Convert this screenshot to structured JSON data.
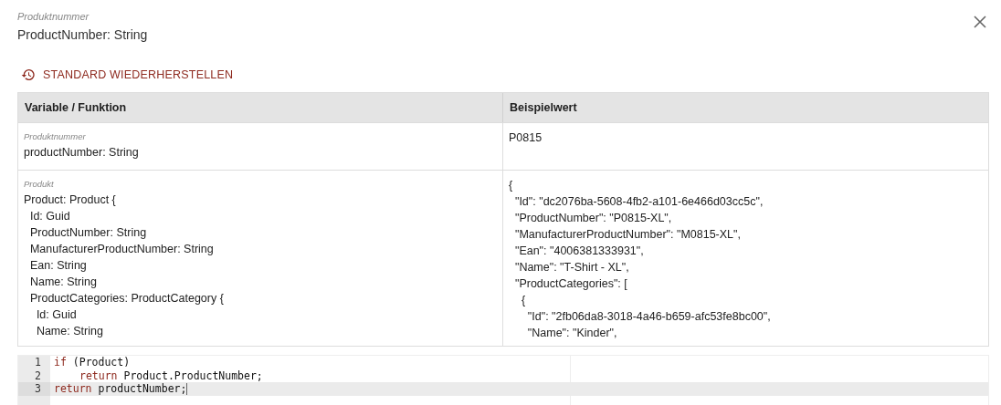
{
  "dialog": {
    "caption": "Produktnummer",
    "title": "ProductNumber: String"
  },
  "reset_button": {
    "label": "STANDARD WIEDERHERSTELLEN"
  },
  "table": {
    "columns": [
      "Variable / Funktion",
      "Beispielwert"
    ],
    "rows": [
      {
        "caption": "Produktnummer",
        "variable": [
          "productNumber: String"
        ],
        "example": [
          "P0815"
        ]
      },
      {
        "caption": "Produkt",
        "variable": [
          "Product: Product {",
          "  Id: Guid",
          "  ProductNumber: String",
          "  ManufacturerProductNumber: String",
          "  Ean: String",
          "  Name: String",
          "  ProductCategories: ProductCategory {",
          "    Id: Guid",
          "    Name: String"
        ],
        "example": [
          "{",
          "  \"Id\": \"dc2076ba-5608-4fb2-a101-6e466d03cc5c\",",
          "  \"ProductNumber\": \"P0815-XL\",",
          "  \"ManufacturerProductNumber\": \"M0815-XL\",",
          "  \"Ean\": \"4006381333931\",",
          "  \"Name\": \"T-Shirt - XL\",",
          "  \"ProductCategories\": [",
          "    {",
          "      \"Id\": \"2fb06da8-3018-4a46-b659-afc53fe8bc00\",",
          "      \"Name\": \"Kinder\","
        ]
      }
    ]
  },
  "editor": {
    "lines": [
      {
        "number": "1",
        "selected": false,
        "indented": false,
        "tokens": [
          {
            "kind": "keyword",
            "text": "if"
          },
          {
            "kind": "plain",
            "text": " (Product)"
          }
        ]
      },
      {
        "number": "2",
        "selected": false,
        "indented": true,
        "tokens": [
          {
            "kind": "keyword",
            "text": "return"
          },
          {
            "kind": "plain",
            "text": " Product.ProductNumber;"
          }
        ]
      },
      {
        "number": "3",
        "selected": true,
        "indented": false,
        "tokens": [
          {
            "kind": "keyword",
            "text": "return"
          },
          {
            "kind": "plain",
            "text": " productNumber;"
          }
        ]
      }
    ]
  }
}
